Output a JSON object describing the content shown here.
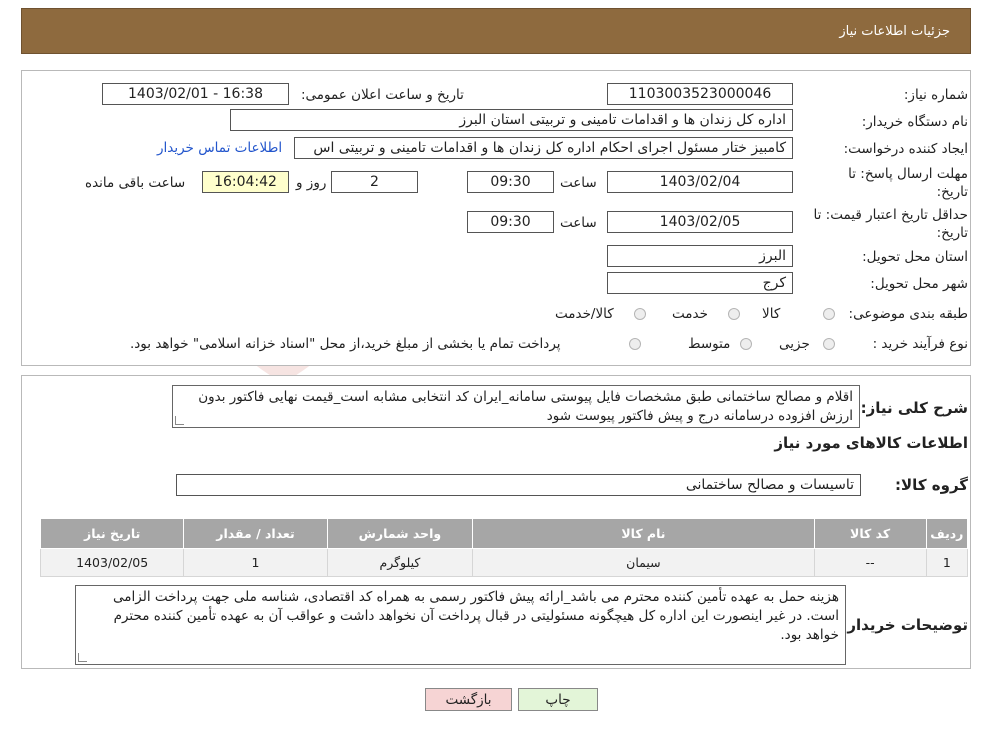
{
  "header": {
    "title": "جزئیات اطلاعات نیاز"
  },
  "fields": {
    "need_number_label": "شماره نیاز:",
    "need_number": "1103003523000046",
    "announce_label": "تاریخ و ساعت اعلان عمومی:",
    "announce_value": "1403/02/01 - 16:38",
    "buyer_label": "نام دستگاه خریدار:",
    "buyer_value": "اداره کل زندان ها و اقدامات تامینی و تربیتی استان البرز",
    "creator_label": "ایجاد کننده درخواست:",
    "creator_value": "کامبیز ختار مسئول اجرای احکام اداره کل زندان ها و اقدامات تامینی و تربیتی اس",
    "contact_link": "اطلاعات تماس خریدار",
    "deadline_label_1": "مهلت ارسال پاسخ: تا",
    "deadline_label_2": "تاریخ:",
    "deadline_date": "1403/02/04",
    "time_label": "ساعت",
    "deadline_time": "09:30",
    "days_value": "2",
    "days_label": "روز و",
    "remaining_time": "16:04:42",
    "remaining_label": "ساعت باقی مانده",
    "validity_label_1": "حداقل تاریخ اعتبار قیمت: تا",
    "validity_label_2": "تاریخ:",
    "validity_date": "1403/02/05",
    "validity_time": "09:30",
    "province_label": "استان محل تحویل:",
    "province_value": "البرز",
    "city_label": "شهر محل تحویل:",
    "city_value": "کرج",
    "category_label": "طبقه بندی موضوعی:",
    "category_options": [
      "کالا",
      "خدمت",
      "کالا/خدمت"
    ],
    "process_label": "نوع فرآیند خرید :",
    "process_options": [
      "جزیی",
      "متوسط"
    ],
    "process_note": "پرداخت تمام یا بخشی از مبلغ خرید،از محل \"اسناد خزانه اسلامی\" خواهد بود."
  },
  "description": {
    "label": "شرح کلی نیاز:",
    "text": "اقلام و مصالح ساختمانی طبق مشخصات فایل پیوستی سامانه_ایران کد انتخابی مشابه است_قیمت نهایی فاکتور بدون ارزش افزوده درسامانه درج و پیش فاکتور پیوست شود",
    "goods_title": "اطلاعات کالاهای مورد نیاز",
    "group_label": "گروه کالا:",
    "group_value": "تاسیسات و مصالح ساختمانی"
  },
  "table": {
    "headers": [
      "ردیف",
      "کد کالا",
      "نام کالا",
      "واحد شمارش",
      "تعداد / مقدار",
      "تاریخ نیاز"
    ],
    "rows": [
      [
        "1",
        "--",
        "سیمان",
        "کیلوگرم",
        "1",
        "1403/02/05"
      ]
    ]
  },
  "buyer_notes": {
    "label": "توضیحات خریدار:",
    "text": "هزینه حمل به عهده تأمین کننده محترم می باشد_ارائه پیش فاکتور رسمی به همراه کد اقتصادی، شناسه ملی جهت پرداخت الزامی است. در غیر اینصورت این اداره کل هیچگونه مسئولیتی در قبال پرداخت آن نخواهد داشت و عواقب آن به عهده تأمین کننده محترم خواهد بود."
  },
  "buttons": {
    "print": "چاپ",
    "back": "بازگشت"
  },
  "colors": {
    "header_bg": "#8e6a3e",
    "back_btn_bg": "#f6d4d4",
    "print_btn_bg": "#e3f5d8",
    "link": "#2255cc"
  }
}
